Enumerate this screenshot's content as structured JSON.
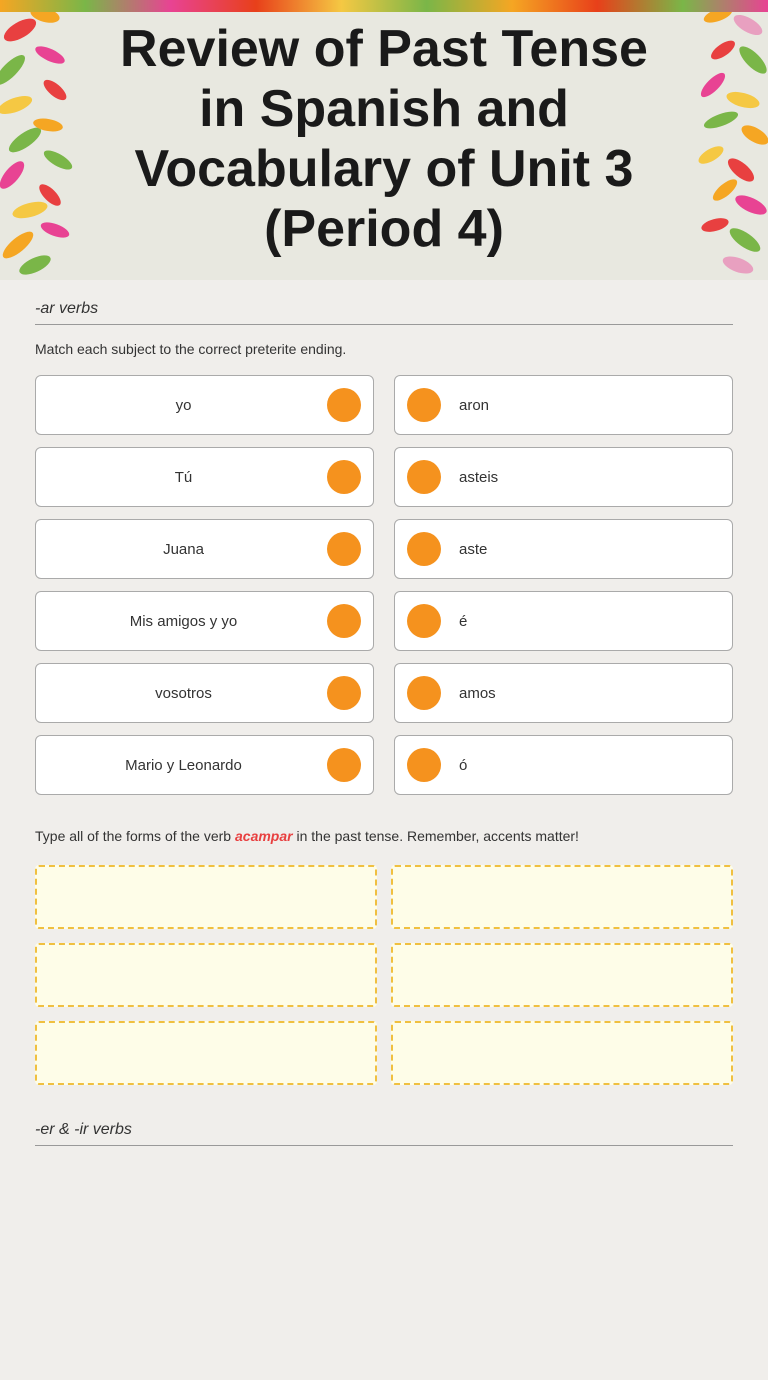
{
  "header": {
    "title_line1": "Review of Past Tense",
    "title_line2": "in Spanish and",
    "title_line3": "Vocabulary of Unit 3",
    "title_line4": "(Period 4)"
  },
  "section1": {
    "heading": "-ar verbs",
    "instruction": "Match each subject to the correct preterite ending.",
    "left_items": [
      "yo",
      "Tú",
      "Juana",
      "Mis amigos y yo",
      "vosotros",
      "Mario y Leonardo"
    ],
    "right_items": [
      "aron",
      "asteis",
      "aste",
      "é",
      "amos",
      "ó"
    ]
  },
  "section2": {
    "instruction_pre": "Type all of the forms of the verb ",
    "verb": "acampar",
    "instruction_post": " in the past tense. Remember, accents matter!",
    "inputs": [
      "",
      "",
      "",
      "",
      "",
      ""
    ]
  },
  "section3": {
    "heading": "-er & -ir verbs"
  }
}
